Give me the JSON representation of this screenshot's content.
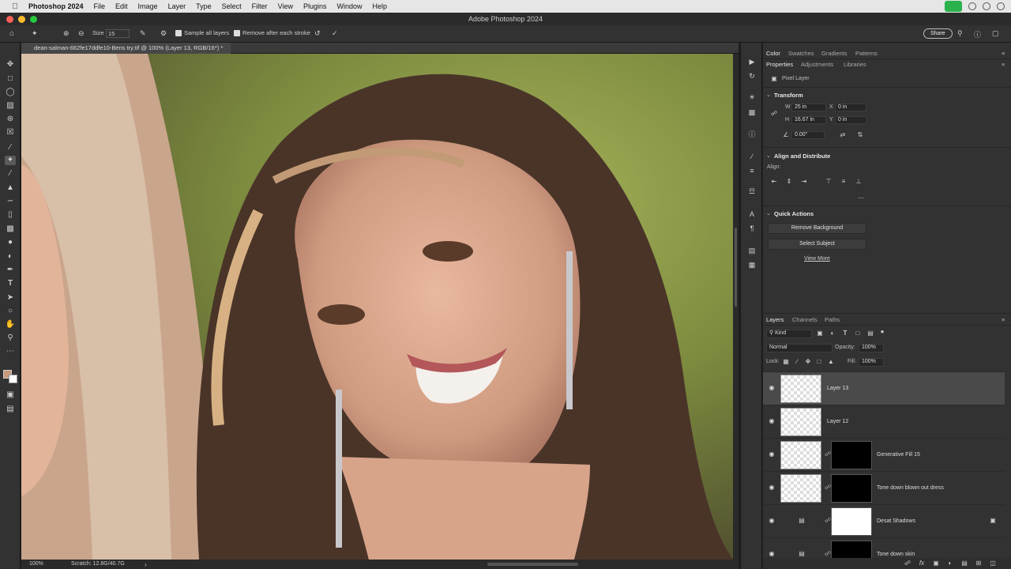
{
  "menubar": {
    "app_name": "Photoshop 2024",
    "items": [
      "File",
      "Edit",
      "Image",
      "Layer",
      "Type",
      "Select",
      "Filter",
      "View",
      "Plugins",
      "Window",
      "Help"
    ]
  },
  "window": {
    "title": "Adobe Photoshop 2024"
  },
  "options": {
    "size_label": "Size",
    "size_value": "15",
    "sample_all_layers": "Sample all layers",
    "remove_after_stroke": "Remove after each stroke",
    "share": "Share"
  },
  "document": {
    "tab_title": "dean-salman-662fe17ddfe10-Bens try.tif @ 100% (Layer 13, RGB/16*) *"
  },
  "status": {
    "zoom": "100%",
    "scratch": "Scratch: 12.8G/40.7G"
  },
  "panel_top": {
    "tabs": [
      "Color",
      "Swatches",
      "Gradients",
      "Patterns"
    ],
    "active_tab": "Color"
  },
  "properties": {
    "tabs": [
      "Properties",
      "Adjustments",
      "Libraries"
    ],
    "active_tab": "Properties",
    "kind": "Pixel Layer",
    "transform_header": "Transform",
    "w_label": "W",
    "w_value": "25 in",
    "h_label": "H",
    "h_value": "16.67 in",
    "x_label": "X",
    "x_value": "0 in",
    "y_label": "Y",
    "y_value": "0 in",
    "angle_value": "0.00°",
    "align_header": "Align and Distribute",
    "align_label": "Align:",
    "quick_header": "Quick Actions",
    "remove_bg": "Remove Background",
    "select_subject": "Select Subject",
    "view_more": "View More"
  },
  "layers_panel": {
    "tabs": [
      "Layers",
      "Channels",
      "Paths"
    ],
    "active_tab": "Layers",
    "filter_kind": "Kind",
    "blend_mode": "Normal",
    "opacity_label": "Opacity:",
    "opacity_value": "100%",
    "lock_label": "Lock:",
    "fill_label": "Fill:",
    "fill_value": "100%",
    "layers": [
      {
        "name": "Layer 13",
        "selected": true,
        "mask": "none"
      },
      {
        "name": "Layer 12",
        "selected": false,
        "mask": "none"
      },
      {
        "name": "Generative Fill 15",
        "selected": false,
        "mask": "black"
      },
      {
        "name": "Tone down blown out dress",
        "selected": false,
        "mask": "black"
      },
      {
        "name": "Desat Shadows",
        "selected": false,
        "mask": "white"
      },
      {
        "name": "Tone down skin",
        "selected": false,
        "mask": "black"
      }
    ]
  },
  "colors": {
    "accent": "#2bb24c",
    "panel_bg": "#323232",
    "selected_layer": "#4a4a4a"
  }
}
